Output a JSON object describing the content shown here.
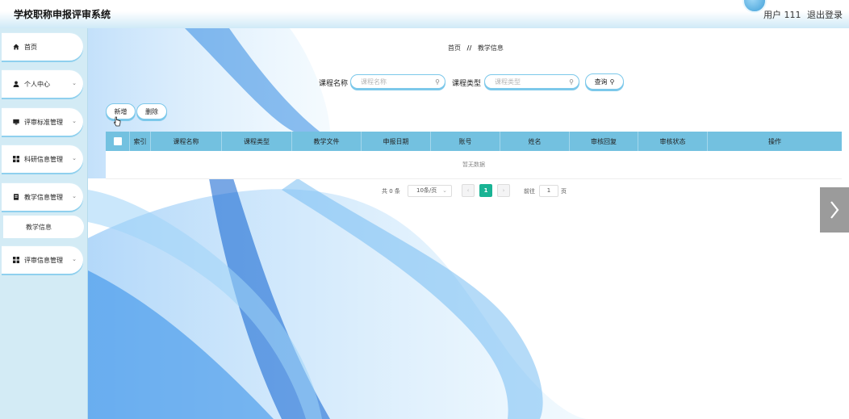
{
  "header": {
    "app_title": "学校职称申报评审系统",
    "user_label": "用户 111",
    "logout_label": "退出登录"
  },
  "sidebar": {
    "items": [
      {
        "label": "首页",
        "icon": "home-icon"
      },
      {
        "label": "个人中心",
        "icon": "user-icon"
      },
      {
        "label": "评审标准管理",
        "icon": "monitor-icon"
      },
      {
        "label": "科研信息管理",
        "icon": "grid-icon"
      },
      {
        "label": "教学信息管理",
        "icon": "document-icon"
      },
      {
        "label": "评审信息管理",
        "icon": "grid-icon"
      }
    ],
    "sub_item": "教学信息"
  },
  "breadcrumb": {
    "home": "首页",
    "separator": "//",
    "current": "教学信息"
  },
  "search": {
    "course_name_label": "课程名称",
    "course_name_placeholder": "课程名称",
    "course_type_label": "课程类型",
    "course_type_placeholder": "课程类型",
    "query_button": "查询"
  },
  "actions": {
    "add_button": "新增",
    "delete_button": "删除"
  },
  "table": {
    "columns": [
      "索引",
      "课程名称",
      "课程类型",
      "教学文件",
      "申报日期",
      "账号",
      "姓名",
      "审核回复",
      "审核状态",
      "操作"
    ],
    "empty_text": "暂无数据"
  },
  "pagination": {
    "total": "共 0 条",
    "page_size": "10条/页",
    "current_page": "1",
    "goto_label": "前往",
    "goto_value": "1",
    "page_unit": "页"
  },
  "colors": {
    "accent": "#73c1e0",
    "pager_active": "#19b394",
    "sidebar_bg": "#d3ebf5"
  }
}
